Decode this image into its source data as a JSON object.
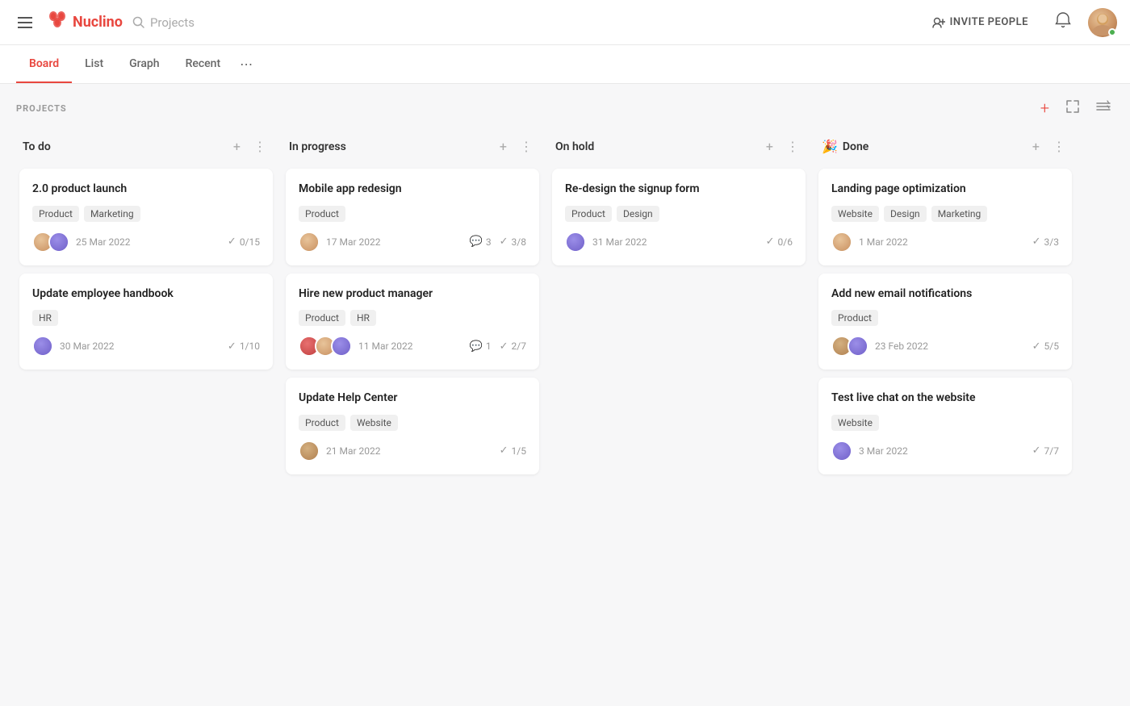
{
  "app": {
    "name": "Nuclino",
    "search_placeholder": "Projects"
  },
  "nav": {
    "invite_label": "INVITE PEOPLE",
    "tabs": [
      {
        "id": "board",
        "label": "Board",
        "active": true
      },
      {
        "id": "list",
        "label": "List",
        "active": false
      },
      {
        "id": "graph",
        "label": "Graph",
        "active": false
      },
      {
        "id": "recent",
        "label": "Recent",
        "active": false
      }
    ]
  },
  "board": {
    "section_label": "PROJECTS",
    "columns": [
      {
        "id": "todo",
        "title": "To do",
        "emoji": "",
        "cards": [
          {
            "id": "c1",
            "title": "2.0 product launch",
            "tags": [
              "Product",
              "Marketing"
            ],
            "avatars": [
              "av1",
              "av2"
            ],
            "date": "25 Mar 2022",
            "checks": "0/15",
            "comments": null
          },
          {
            "id": "c2",
            "title": "Update employee handbook",
            "tags": [
              "HR"
            ],
            "avatars": [
              "av5"
            ],
            "date": "30 Mar 2022",
            "checks": "1/10",
            "comments": null
          }
        ]
      },
      {
        "id": "inprogress",
        "title": "In progress",
        "emoji": "",
        "cards": [
          {
            "id": "c3",
            "title": "Mobile app redesign",
            "tags": [
              "Product"
            ],
            "avatars": [
              "av1"
            ],
            "date": "17 Mar 2022",
            "checks": "3/8",
            "comments": "3"
          },
          {
            "id": "c4",
            "title": "Hire new product manager",
            "tags": [
              "Product",
              "HR"
            ],
            "avatars": [
              "av3",
              "av1",
              "av2"
            ],
            "date": "11 Mar 2022",
            "checks": "2/7",
            "comments": "1"
          },
          {
            "id": "c5",
            "title": "Update Help Center",
            "tags": [
              "Product",
              "Website"
            ],
            "avatars": [
              "av4"
            ],
            "date": "21 Mar 2022",
            "checks": "1/5",
            "comments": null
          }
        ]
      },
      {
        "id": "onhold",
        "title": "On hold",
        "emoji": "",
        "cards": [
          {
            "id": "c6",
            "title": "Re-design the signup form",
            "tags": [
              "Product",
              "Design"
            ],
            "avatars": [
              "av2"
            ],
            "date": "31 Mar 2022",
            "checks": "0/6",
            "comments": null
          }
        ]
      },
      {
        "id": "done",
        "title": "Done",
        "emoji": "🎉",
        "cards": [
          {
            "id": "c7",
            "title": "Landing page optimization",
            "tags": [
              "Website",
              "Design",
              "Marketing"
            ],
            "avatars": [
              "av1"
            ],
            "date": "1 Mar 2022",
            "checks": "3/3",
            "comments": null
          },
          {
            "id": "c8",
            "title": "Add new email notifications",
            "tags": [
              "Product"
            ],
            "avatars": [
              "av4",
              "av2"
            ],
            "date": "23 Feb 2022",
            "checks": "5/5",
            "comments": null
          },
          {
            "id": "c9",
            "title": "Test live chat on the website",
            "tags": [
              "Website"
            ],
            "avatars": [
              "av2"
            ],
            "date": "3 Mar 2022",
            "checks": "7/7",
            "comments": null
          }
        ]
      }
    ]
  }
}
